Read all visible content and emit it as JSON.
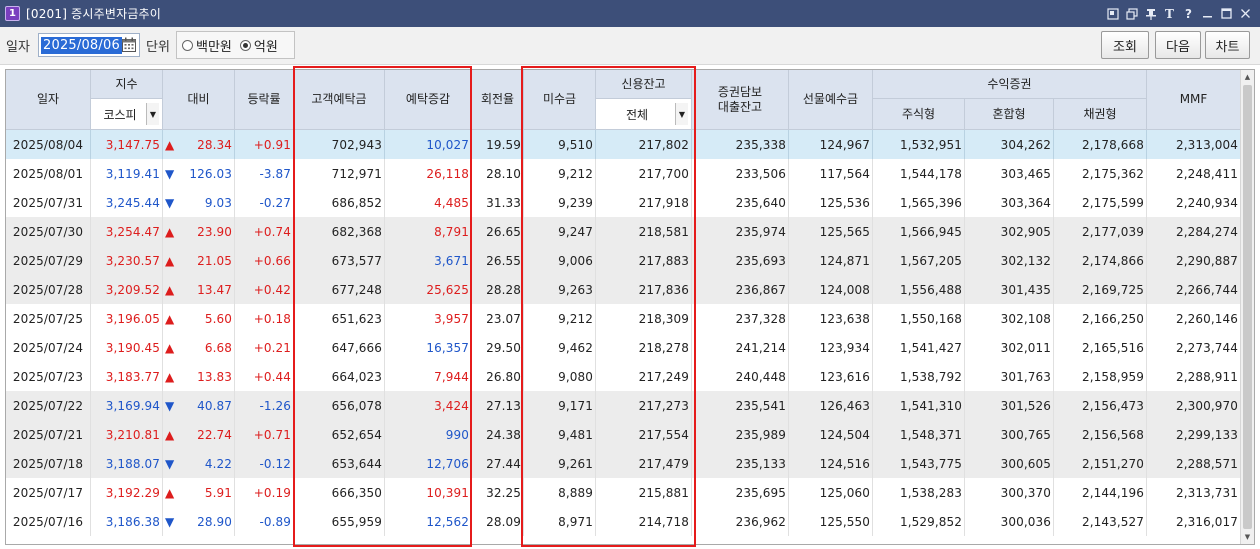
{
  "window": {
    "badge": "1",
    "title": "[0201] 증시주변자금추이"
  },
  "toolbar": {
    "date_label": "일자",
    "date_value": "2025/08/06",
    "unit_label": "단위",
    "unit_options": [
      "백만원",
      "억원"
    ],
    "unit_selected": "억원",
    "buttons": {
      "query": "조회",
      "next": "다음",
      "chart": "차트"
    }
  },
  "columns": {
    "date": "일자",
    "index": "지수",
    "index_select": "코스피",
    "change": "대비",
    "rate": "등락률",
    "deposit": "고객예탁금",
    "deposit_change": "예탁증감",
    "turnover": "회전율",
    "receivable": "미수금",
    "credit": "신용잔고",
    "credit_select": "전체",
    "loan": "증권담보\n대출잔고",
    "futures": "선물예수금",
    "fund": "수익증권",
    "fund_stock": "주식형",
    "fund_mixed": "혼합형",
    "fund_bond": "채권형",
    "mmf": "MMF"
  },
  "rows": [
    {
      "date": "2025/08/04",
      "index": "3,147.75",
      "dir": "up",
      "change": "28.34",
      "rate": "+0.91",
      "deposit": "702,943",
      "dep_chg": "10,027",
      "dep_dir": "dn",
      "turnover": "19.59",
      "recv": "9,510",
      "credit": "217,802",
      "loan": "235,338",
      "futures": "124,967",
      "stock": "1,532,951",
      "mixed": "304,262",
      "bond": "2,178,668",
      "mmf": "2,313,004"
    },
    {
      "date": "2025/08/01",
      "index": "3,119.41",
      "dir": "dn",
      "change": "126.03",
      "rate": "-3.87",
      "deposit": "712,971",
      "dep_chg": "26,118",
      "dep_dir": "up",
      "turnover": "28.10",
      "recv": "9,212",
      "credit": "217,700",
      "loan": "233,506",
      "futures": "117,564",
      "stock": "1,544,178",
      "mixed": "303,465",
      "bond": "2,175,362",
      "mmf": "2,248,411"
    },
    {
      "date": "2025/07/31",
      "index": "3,245.44",
      "dir": "dn",
      "change": "9.03",
      "rate": "-0.27",
      "deposit": "686,852",
      "dep_chg": "4,485",
      "dep_dir": "up",
      "turnover": "31.33",
      "recv": "9,239",
      "credit": "217,918",
      "loan": "235,640",
      "futures": "125,536",
      "stock": "1,565,396",
      "mixed": "303,364",
      "bond": "2,175,599",
      "mmf": "2,240,934"
    },
    {
      "date": "2025/07/30",
      "index": "3,254.47",
      "dir": "up",
      "change": "23.90",
      "rate": "+0.74",
      "deposit": "682,368",
      "dep_chg": "8,791",
      "dep_dir": "up",
      "turnover": "26.65",
      "recv": "9,247",
      "credit": "218,581",
      "loan": "235,974",
      "futures": "125,565",
      "stock": "1,566,945",
      "mixed": "302,905",
      "bond": "2,177,039",
      "mmf": "2,284,274"
    },
    {
      "date": "2025/07/29",
      "index": "3,230.57",
      "dir": "up",
      "change": "21.05",
      "rate": "+0.66",
      "deposit": "673,577",
      "dep_chg": "3,671",
      "dep_dir": "dn",
      "turnover": "26.55",
      "recv": "9,006",
      "credit": "217,883",
      "loan": "235,693",
      "futures": "124,871",
      "stock": "1,567,205",
      "mixed": "302,132",
      "bond": "2,174,866",
      "mmf": "2,290,887"
    },
    {
      "date": "2025/07/28",
      "index": "3,209.52",
      "dir": "up",
      "change": "13.47",
      "rate": "+0.42",
      "deposit": "677,248",
      "dep_chg": "25,625",
      "dep_dir": "up",
      "turnover": "28.28",
      "recv": "9,263",
      "credit": "217,836",
      "loan": "236,867",
      "futures": "124,008",
      "stock": "1,556,488",
      "mixed": "301,435",
      "bond": "2,169,725",
      "mmf": "2,266,744"
    },
    {
      "date": "2025/07/25",
      "index": "3,196.05",
      "dir": "up",
      "change": "5.60",
      "rate": "+0.18",
      "deposit": "651,623",
      "dep_chg": "3,957",
      "dep_dir": "up",
      "turnover": "23.07",
      "recv": "9,212",
      "credit": "218,309",
      "loan": "237,328",
      "futures": "123,638",
      "stock": "1,550,168",
      "mixed": "302,108",
      "bond": "2,166,250",
      "mmf": "2,260,146"
    },
    {
      "date": "2025/07/24",
      "index": "3,190.45",
      "dir": "up",
      "change": "6.68",
      "rate": "+0.21",
      "deposit": "647,666",
      "dep_chg": "16,357",
      "dep_dir": "dn",
      "turnover": "29.50",
      "recv": "9,462",
      "credit": "218,278",
      "loan": "241,214",
      "futures": "123,934",
      "stock": "1,541,427",
      "mixed": "302,011",
      "bond": "2,165,516",
      "mmf": "2,273,744"
    },
    {
      "date": "2025/07/23",
      "index": "3,183.77",
      "dir": "up",
      "change": "13.83",
      "rate": "+0.44",
      "deposit": "664,023",
      "dep_chg": "7,944",
      "dep_dir": "up",
      "turnover": "26.80",
      "recv": "9,080",
      "credit": "217,249",
      "loan": "240,448",
      "futures": "123,616",
      "stock": "1,538,792",
      "mixed": "301,763",
      "bond": "2,158,959",
      "mmf": "2,288,911"
    },
    {
      "date": "2025/07/22",
      "index": "3,169.94",
      "dir": "dn",
      "change": "40.87",
      "rate": "-1.26",
      "deposit": "656,078",
      "dep_chg": "3,424",
      "dep_dir": "up",
      "turnover": "27.13",
      "recv": "9,171",
      "credit": "217,273",
      "loan": "235,541",
      "futures": "126,463",
      "stock": "1,541,310",
      "mixed": "301,526",
      "bond": "2,156,473",
      "mmf": "2,300,970"
    },
    {
      "date": "2025/07/21",
      "index": "3,210.81",
      "dir": "up",
      "change": "22.74",
      "rate": "+0.71",
      "deposit": "652,654",
      "dep_chg": "990",
      "dep_dir": "dn",
      "turnover": "24.38",
      "recv": "9,481",
      "credit": "217,554",
      "loan": "235,989",
      "futures": "124,504",
      "stock": "1,548,371",
      "mixed": "300,765",
      "bond": "2,156,568",
      "mmf": "2,299,133"
    },
    {
      "date": "2025/07/18",
      "index": "3,188.07",
      "dir": "dn",
      "change": "4.22",
      "rate": "-0.12",
      "deposit": "653,644",
      "dep_chg": "12,706",
      "dep_dir": "dn",
      "turnover": "27.44",
      "recv": "9,261",
      "credit": "217,479",
      "loan": "235,133",
      "futures": "124,516",
      "stock": "1,543,775",
      "mixed": "300,605",
      "bond": "2,151,270",
      "mmf": "2,288,571"
    },
    {
      "date": "2025/07/17",
      "index": "3,192.29",
      "dir": "up",
      "change": "5.91",
      "rate": "+0.19",
      "deposit": "666,350",
      "dep_chg": "10,391",
      "dep_dir": "up",
      "turnover": "32.25",
      "recv": "8,889",
      "credit": "215,881",
      "loan": "235,695",
      "futures": "125,060",
      "stock": "1,538,283",
      "mixed": "300,370",
      "bond": "2,144,196",
      "mmf": "2,313,731"
    },
    {
      "date": "2025/07/16",
      "index": "3,186.38",
      "dir": "dn",
      "change": "28.90",
      "rate": "-0.89",
      "deposit": "655,959",
      "dep_chg": "12,562",
      "dep_dir": "dn",
      "turnover": "28.09",
      "recv": "8,971",
      "credit": "214,718",
      "loan": "236,962",
      "futures": "125,550",
      "stock": "1,529,852",
      "mixed": "300,036",
      "bond": "2,143,527",
      "mmf": "2,316,017"
    }
  ],
  "colors": {
    "up": "#dd1d1d",
    "down": "#1f56c9",
    "highlight_box": "#e51b1b",
    "title_bar": "#3d4f79",
    "selected_row": "#d6ebf7",
    "header": "#dbe3ef"
  }
}
